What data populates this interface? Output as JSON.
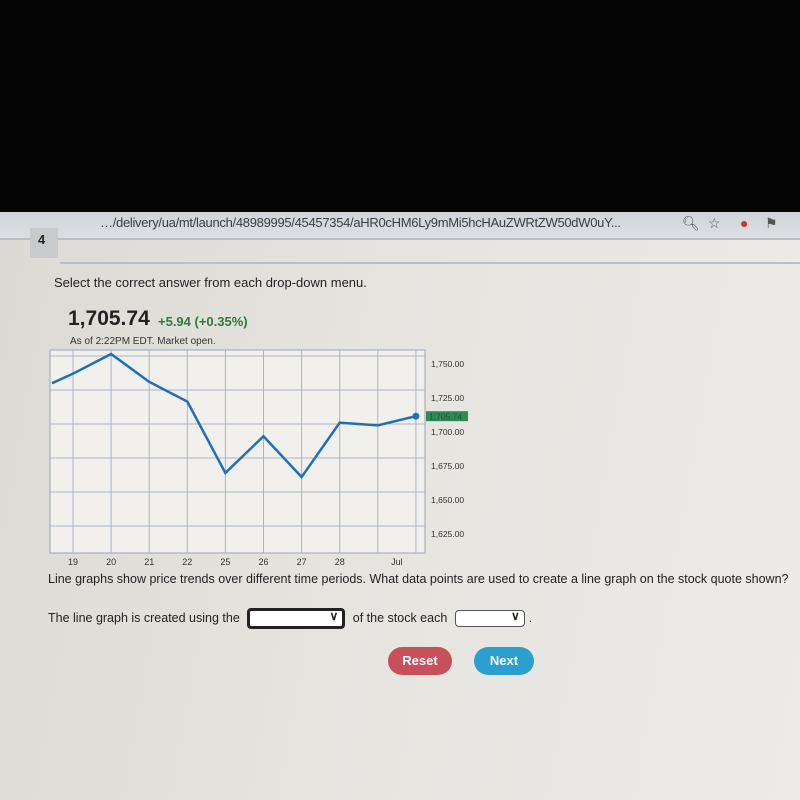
{
  "browser": {
    "url": "…/delivery/ua/mt/launch/48989995/45457354/aHR0cHM6Ly9mMi5hcHAuZWRtZW50dW0uY...",
    "icons": [
      "zoom-icon",
      "star-icon",
      "extension-icon",
      "extension-icon-2"
    ]
  },
  "question_number": "4",
  "instruction": "Select the correct answer from each drop-down menu.",
  "quote": {
    "price": "1,705.74",
    "change": "+5.94 (+0.35%)",
    "as_of": "As of 2:22PM EDT. Market open.",
    "change_color": "#2f7a3a"
  },
  "chart_data": {
    "type": "line",
    "point_labels": [
      "",
      "19",
      "20",
      "21",
      "22",
      "25",
      "26",
      "27",
      "28",
      "",
      "Jul"
    ],
    "values": [
      1730,
      1737,
      1751.5,
      1731,
      1716.5,
      1664,
      1691,
      1661,
      1701,
      1699,
      1705.74
    ],
    "x_tick_labels": [
      "19",
      "20",
      "21",
      "22",
      "25",
      "26",
      "27",
      "28",
      "Jul"
    ],
    "y_tick_labels": [
      "1,750.00",
      "1,725.00",
      "1,700.00",
      "1,675.00",
      "1,650.00",
      "1,625.00"
    ],
    "y_ticks": [
      1750,
      1725,
      1700,
      1675,
      1650,
      1625
    ],
    "ylim": [
      1617,
      1754
    ],
    "current_label": "1,705.74",
    "current_value": 1705.74,
    "line_color": "#1f6fb8",
    "current_label_color": "#2e8b57",
    "grid": true
  },
  "question": "Line graphs show price trends over different time periods. What data points are used to create a line graph on the stock quote shown?",
  "answer": {
    "part1": "The line graph is created using the",
    "part2": "of the stock each",
    "part3": ".",
    "dropdown1_value": "",
    "dropdown2_value": ""
  },
  "buttons": {
    "reset": "Reset",
    "next": "Next"
  }
}
